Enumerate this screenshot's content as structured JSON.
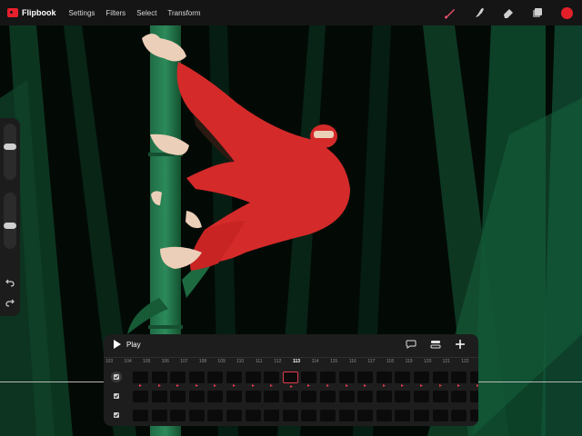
{
  "app": {
    "name": "Flipbook"
  },
  "menu": [
    "Settings",
    "Filters",
    "Select",
    "Transform"
  ],
  "tools": [
    {
      "name": "brush-icon",
      "color": "#e8506a"
    },
    {
      "name": "smudge-icon",
      "color": "#cfcfcf"
    },
    {
      "name": "eraser-icon",
      "color": "#cfcfcf"
    },
    {
      "name": "layers-icon",
      "color": "#cfcfcf"
    }
  ],
  "current_color": "#e3202a",
  "sidebar": {
    "brush_size_level": 0.6,
    "opacity_level": 0.4,
    "undo_icon": "undo-icon",
    "redo_icon": "redo-icon"
  },
  "timeline": {
    "play_label": "Play",
    "tools": [
      "comment-icon",
      "layers-toggle-icon",
      "add-icon"
    ],
    "frame_numbers": [
      "103",
      "104",
      "105",
      "106",
      "107",
      "108",
      "109",
      "110",
      "111",
      "112",
      "113",
      "114",
      "115",
      "116",
      "117",
      "118",
      "119",
      "120",
      "121",
      "122",
      "123"
    ],
    "current_frame": "113",
    "rows": [
      {
        "checked": true,
        "active": true,
        "has_drawing": true
      },
      {
        "checked": true,
        "active": false,
        "has_drawing": false
      },
      {
        "checked": true,
        "active": false,
        "has_drawing": false
      }
    ]
  }
}
